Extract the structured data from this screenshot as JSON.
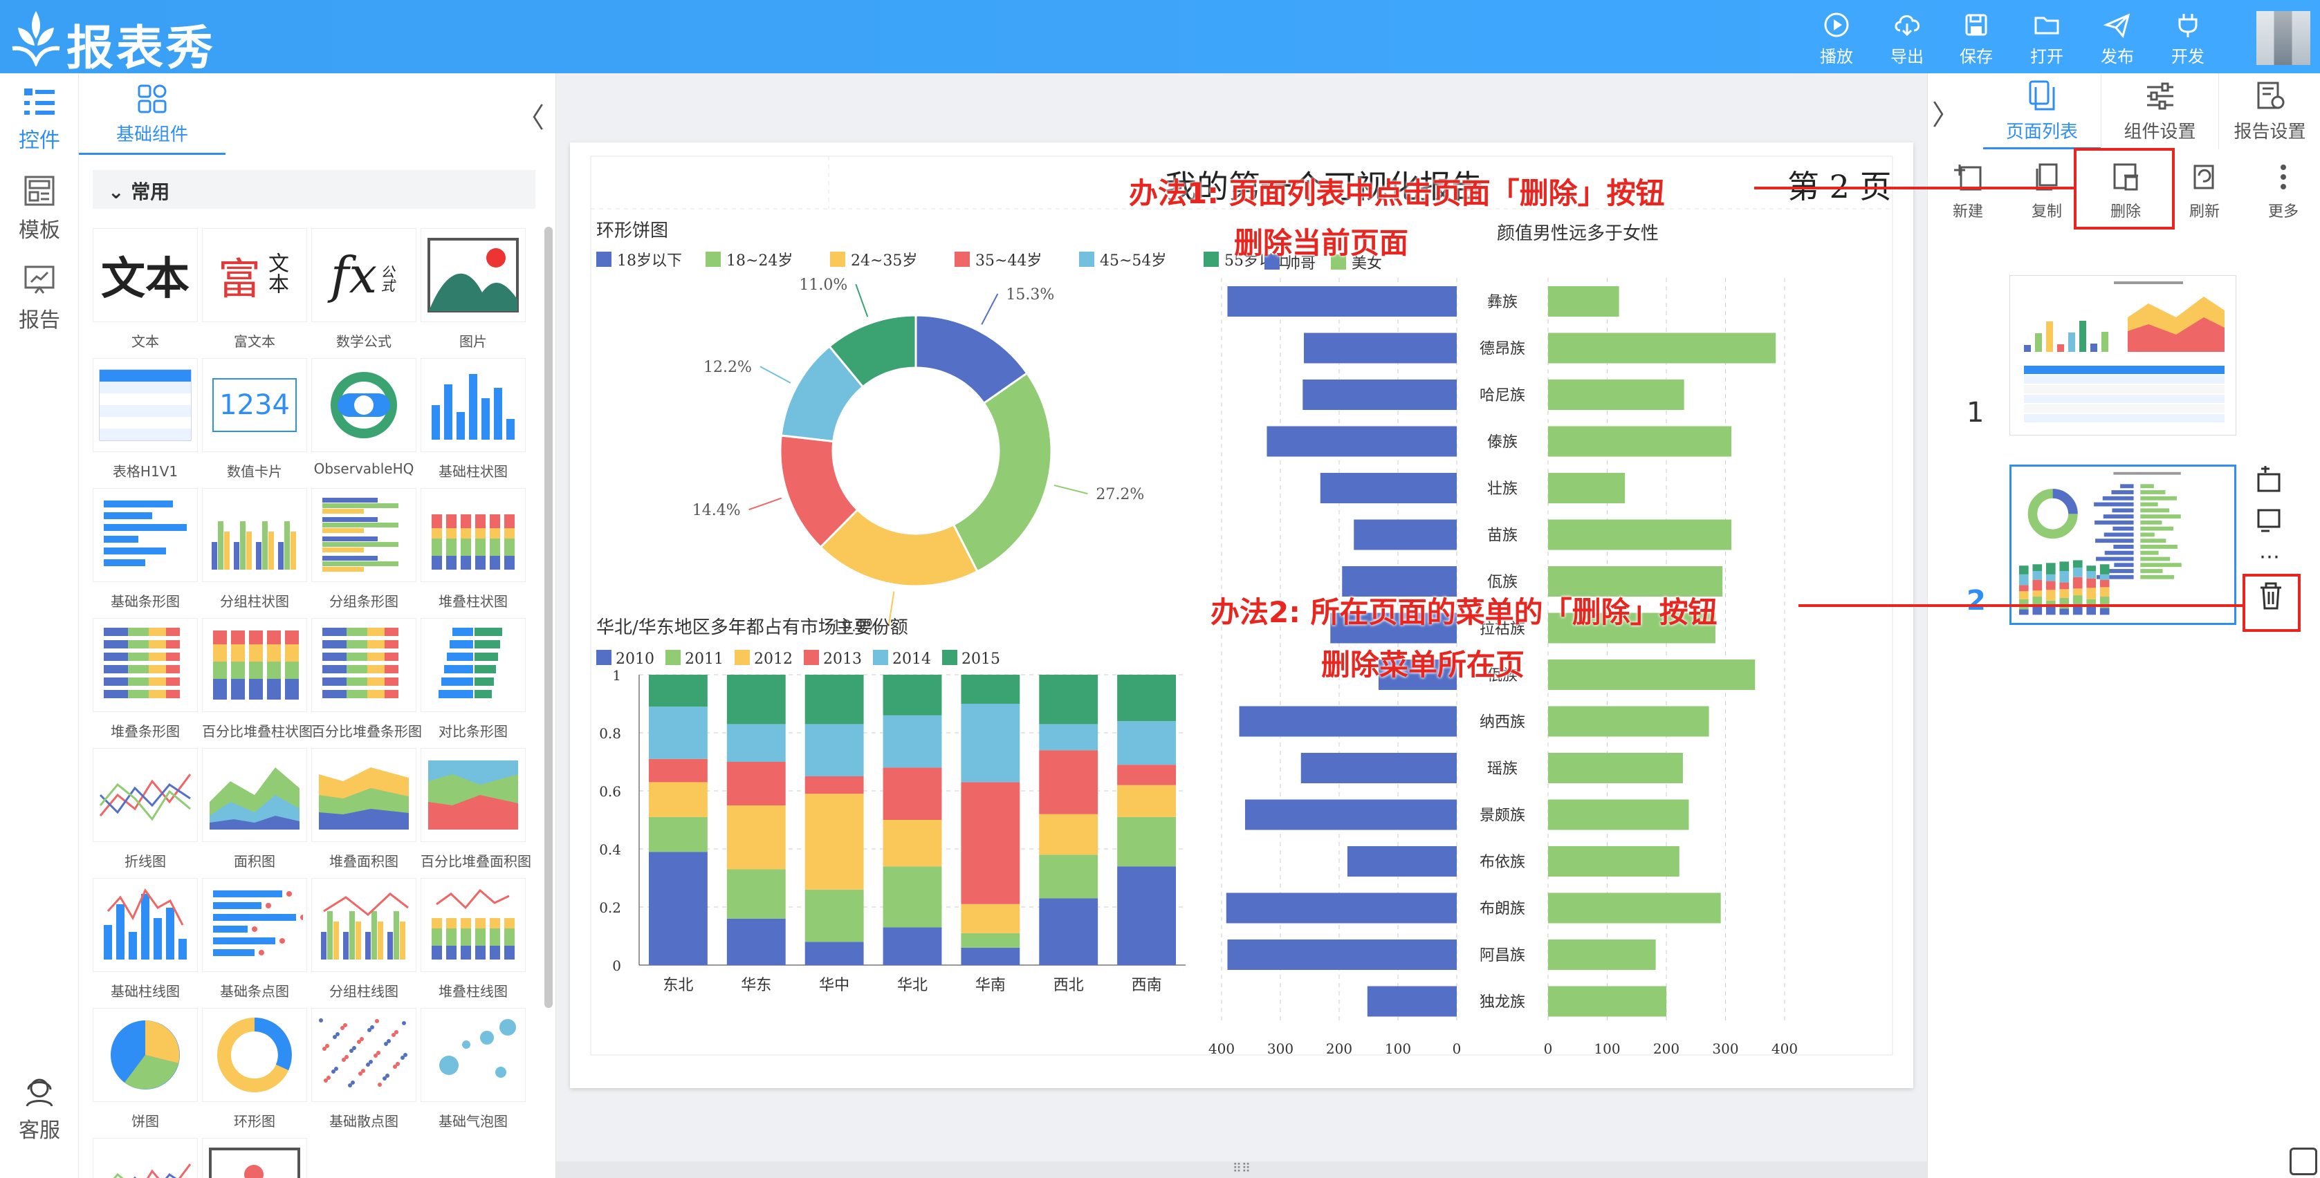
{
  "app": {
    "title": "报表秀"
  },
  "toolbar": [
    {
      "label": "播放",
      "icon": "play-icon"
    },
    {
      "label": "导出",
      "icon": "export-icon"
    },
    {
      "label": "保存",
      "icon": "save-icon"
    },
    {
      "label": "打开",
      "icon": "folder-icon"
    },
    {
      "label": "发布",
      "icon": "send-icon"
    },
    {
      "label": "开发",
      "icon": "plug-icon"
    }
  ],
  "left_rail": [
    {
      "label": "控件",
      "icon": "widgets-icon"
    },
    {
      "label": "模板",
      "icon": "template-icon"
    },
    {
      "label": "报告",
      "icon": "report-icon"
    },
    {
      "label": "客服",
      "icon": "support-icon"
    }
  ],
  "component_panel": {
    "tab": "基础组件",
    "section": "常用",
    "collapse": "〈",
    "tiles": [
      "文本",
      "富文本",
      "数学公式",
      "图片",
      "表格H1V1",
      "数值卡片",
      "ObservableHQ",
      "基础柱状图",
      "基础条形图",
      "分组柱状图",
      "分组条形图",
      "堆叠柱状图",
      "堆叠条形图",
      "百分比堆叠柱状图",
      "百分比堆叠条形图",
      "对比条形图",
      "折线图",
      "面积图",
      "堆叠面积图",
      "百分比堆叠面积图",
      "基础柱线图",
      "基础条点图",
      "分组柱线图",
      "堆叠柱线图",
      "饼图",
      "环形图",
      "基础散点图",
      "基础气泡图"
    ],
    "thumb_text": {
      "text_big": "文本",
      "rich1": "富",
      "rich2": "文本",
      "fx": "fx",
      "fx_sub": "公式",
      "card": "1234"
    }
  },
  "report": {
    "title": "我的第一个可视化报告",
    "page_label": "第 2 页",
    "bottom_handle": "⠿⠿"
  },
  "chart_data": [
    {
      "type": "pie",
      "title": "环形饼图",
      "categories": [
        "18岁以下",
        "18~24岁",
        "24~35岁",
        "35~44岁",
        "45~54岁",
        "55岁以上"
      ],
      "values": [
        15.3,
        27.2,
        19.9,
        14.4,
        12.2,
        11.0
      ],
      "labels": [
        "15.3%",
        "27.2%",
        "19.9%",
        "14.4%",
        "12.2%",
        "11.0%"
      ],
      "colors": [
        "#5470c6",
        "#91cc75",
        "#fac858",
        "#ee6666",
        "#73c0de",
        "#3ba272"
      ],
      "donut": true,
      "legend": "top-left"
    },
    {
      "type": "bar",
      "orientation": "horizontal-compare",
      "title": "颜值男性远多于女性",
      "categories": [
        "彝族",
        "德昂族",
        "哈尼族",
        "傣族",
        "壮族",
        "苗族",
        "佤族",
        "拉祜族",
        "佤族",
        "纳西族",
        "瑶族",
        "景颇族",
        "布依族",
        "布朗族",
        "阿昌族",
        "独龙族"
      ],
      "series": [
        {
          "name": "帅哥",
          "color": "#5470c6",
          "values": [
            390,
            260,
            262,
            323,
            232,
            175,
            195,
            215,
            133,
            370,
            265,
            360,
            186,
            392,
            390,
            152
          ]
        },
        {
          "name": "美女",
          "color": "#91cc75",
          "values": [
            120,
            385,
            230,
            310,
            130,
            310,
            295,
            283,
            350,
            272,
            228,
            238,
            222,
            292,
            182,
            200
          ]
        }
      ],
      "xticks_left": [
        "400",
        "300",
        "200",
        "100",
        "0"
      ],
      "xticks_right": [
        "0",
        "100",
        "200",
        "300",
        "400"
      ],
      "xlim": [
        0,
        400
      ],
      "legend": "top-left"
    },
    {
      "type": "bar",
      "stacked": "percent",
      "title": "华北/华东地区多年都占有市场主要份额",
      "categories": [
        "东北",
        "华东",
        "华中",
        "华北",
        "华南",
        "西北",
        "西南"
      ],
      "series": [
        {
          "name": "2010",
          "color": "#5470c6",
          "values": [
            0.39,
            0.16,
            0.08,
            0.13,
            0.06,
            0.23,
            0.34
          ]
        },
        {
          "name": "2011",
          "color": "#91cc75",
          "values": [
            0.12,
            0.17,
            0.18,
            0.21,
            0.05,
            0.15,
            0.17
          ]
        },
        {
          "name": "2012",
          "color": "#fac858",
          "values": [
            0.12,
            0.22,
            0.33,
            0.16,
            0.1,
            0.14,
            0.11
          ]
        },
        {
          "name": "2013",
          "color": "#ee6666",
          "values": [
            0.08,
            0.15,
            0.06,
            0.18,
            0.42,
            0.22,
            0.07
          ]
        },
        {
          "name": "2014",
          "color": "#73c0de",
          "values": [
            0.18,
            0.13,
            0.18,
            0.18,
            0.27,
            0.09,
            0.15
          ]
        },
        {
          "name": "2015",
          "color": "#3ba272",
          "values": [
            0.11,
            0.17,
            0.17,
            0.14,
            0.1,
            0.17,
            0.16
          ]
        }
      ],
      "yticks": [
        "0",
        "0.2",
        "0.4",
        "0.6",
        "0.8",
        "1"
      ],
      "ylim": [
        0,
        1
      ],
      "legend": "top-left"
    }
  ],
  "right_panel": {
    "tabs": [
      {
        "label": "页面列表",
        "icon": "pages-icon"
      },
      {
        "label": "组件设置",
        "icon": "sliders-icon"
      },
      {
        "label": "报告设置",
        "icon": "report-settings-icon"
      }
    ],
    "expand": "〉",
    "buttons": [
      {
        "label": "新建",
        "icon": "add-page-icon"
      },
      {
        "label": "复制",
        "icon": "copy-icon"
      },
      {
        "label": "删除",
        "icon": "delete-page-icon"
      },
      {
        "label": "刷新",
        "icon": "refresh-icon"
      },
      {
        "label": "更多",
        "icon": "more-icon"
      }
    ],
    "pages": [
      "1",
      "2"
    ],
    "page_actions": [
      "⋯"
    ]
  },
  "annotations": {
    "method1_line1": "办法1: 页面列表中点击页面「删除」按钮",
    "method1_line2": "删除当前页面",
    "method2_line1": "办法2: 所在页面的菜单的「删除」按钮",
    "method2_line2": "删除菜单所在页"
  },
  "colors": {
    "accent": "#2f8ef5",
    "annotation": "#e8261f",
    "topbar": "#3aa0f5"
  }
}
